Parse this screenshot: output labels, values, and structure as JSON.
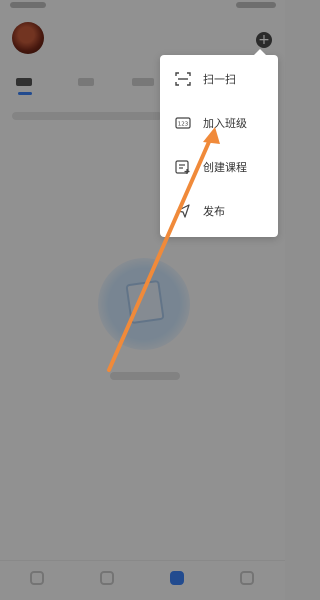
{
  "header": {
    "add_icon": "plus-circle-icon"
  },
  "popup_menu": {
    "items": [
      {
        "label": "扫一扫",
        "icon": "scan-icon"
      },
      {
        "label": "加入班级",
        "icon": "join-class-123-icon"
      },
      {
        "label": "创建课程",
        "icon": "create-course-icon"
      },
      {
        "label": "发布",
        "icon": "send-icon"
      }
    ]
  },
  "annotation": {
    "arrow_color": "#f08a3a"
  },
  "colors": {
    "accent": "#3b82f6",
    "overlay": "rgba(0,0,0,0.42)"
  }
}
